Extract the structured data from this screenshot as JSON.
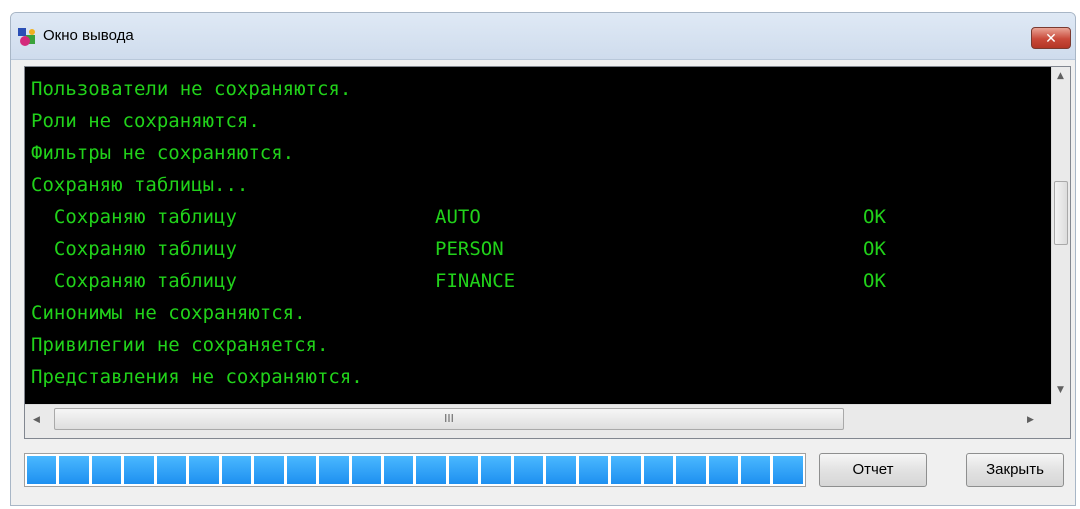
{
  "window": {
    "title": "Окно вывода",
    "close_symbol": "✕"
  },
  "console": {
    "lines": [
      {
        "text": "Пользователи не сохраняются."
      },
      {
        "text": "Роли не сохраняются."
      },
      {
        "text": "Фильтры не сохраняются."
      },
      {
        "text": "Сохраняю таблицы..."
      },
      {
        "text": "  Сохраняю таблицу",
        "table": "AUTO",
        "status": "OK"
      },
      {
        "text": "  Сохраняю таблицу",
        "table": "PERSON",
        "status": "OK"
      },
      {
        "text": "  Сохраняю таблицу",
        "table": "FINANCE",
        "status": "OK"
      },
      {
        "text": "Синонимы не сохраняются."
      },
      {
        "text": "Привилегии не сохраняется."
      },
      {
        "text": "Представления не сохраняются."
      }
    ],
    "text_color": "#21d21a",
    "background_color": "#000000",
    "hscroll_thumb_grip": "III"
  },
  "progress": {
    "fraction": 1.0,
    "segments": 24,
    "color": "#1e90f0"
  },
  "buttons": {
    "report": "Отчет",
    "close": "Закрыть"
  },
  "icons": {
    "app": "output-window-icon",
    "close": "close-icon",
    "scroll_up": "arrow-up-icon",
    "scroll_down": "arrow-down-icon",
    "scroll_left": "arrow-left-icon",
    "scroll_right": "arrow-right-icon"
  }
}
